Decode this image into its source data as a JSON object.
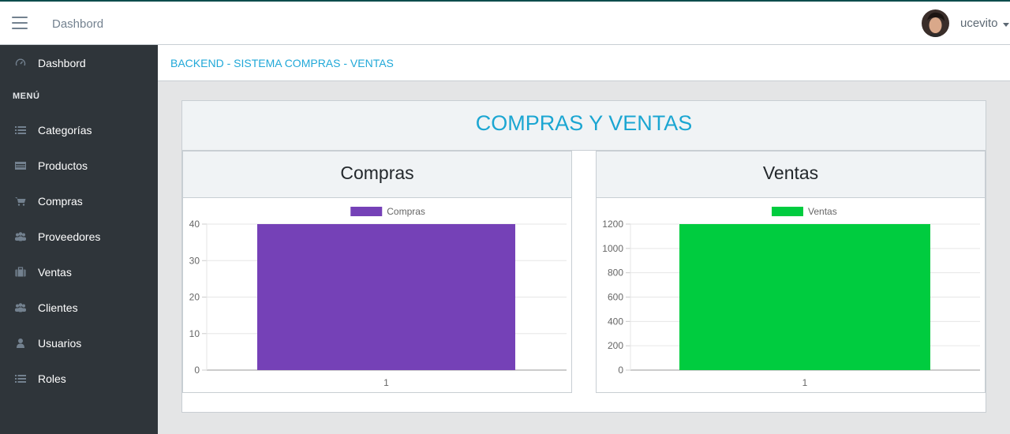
{
  "header": {
    "brand": "Dashbord",
    "username": "ucevito"
  },
  "sidebar": {
    "items": [
      {
        "label": "Dashbord",
        "icon": "speedometer-icon"
      },
      {
        "label": "Categorías",
        "icon": "list-icon"
      },
      {
        "label": "Productos",
        "icon": "card-icon"
      },
      {
        "label": "Compras",
        "icon": "cart-icon"
      },
      {
        "label": "Proveedores",
        "icon": "users-icon"
      },
      {
        "label": "Ventas",
        "icon": "briefcase-icon"
      },
      {
        "label": "Clientes",
        "icon": "users-icon"
      },
      {
        "label": "Usuarios",
        "icon": "user-icon"
      },
      {
        "label": "Roles",
        "icon": "list-icon"
      }
    ],
    "section_title": "MENÚ"
  },
  "breadcrumb": "BACKEND - SISTEMA COMPRAS - VENTAS",
  "card": {
    "title": "COMPRAS Y VENTAS"
  },
  "colors": {
    "accent": "#20a8d8",
    "compras_bar": "#7541b7",
    "ventas_bar": "#00cc3f",
    "sidebar_bg": "#2f353a"
  },
  "chart_data": [
    {
      "type": "bar",
      "title": "Compras",
      "categories": [
        "1"
      ],
      "series": [
        {
          "name": "Compras",
          "values": [
            40
          ]
        }
      ],
      "ylim": [
        0,
        40
      ],
      "yticks": [
        0,
        10,
        20,
        30,
        40
      ],
      "grid": true,
      "legend": "top"
    },
    {
      "type": "bar",
      "title": "Ventas",
      "categories": [
        "1"
      ],
      "series": [
        {
          "name": "Ventas",
          "values": [
            1200
          ]
        }
      ],
      "ylim": [
        0,
        1200
      ],
      "yticks": [
        0,
        200,
        400,
        600,
        800,
        1000,
        1200
      ],
      "grid": true,
      "legend": "top"
    }
  ]
}
